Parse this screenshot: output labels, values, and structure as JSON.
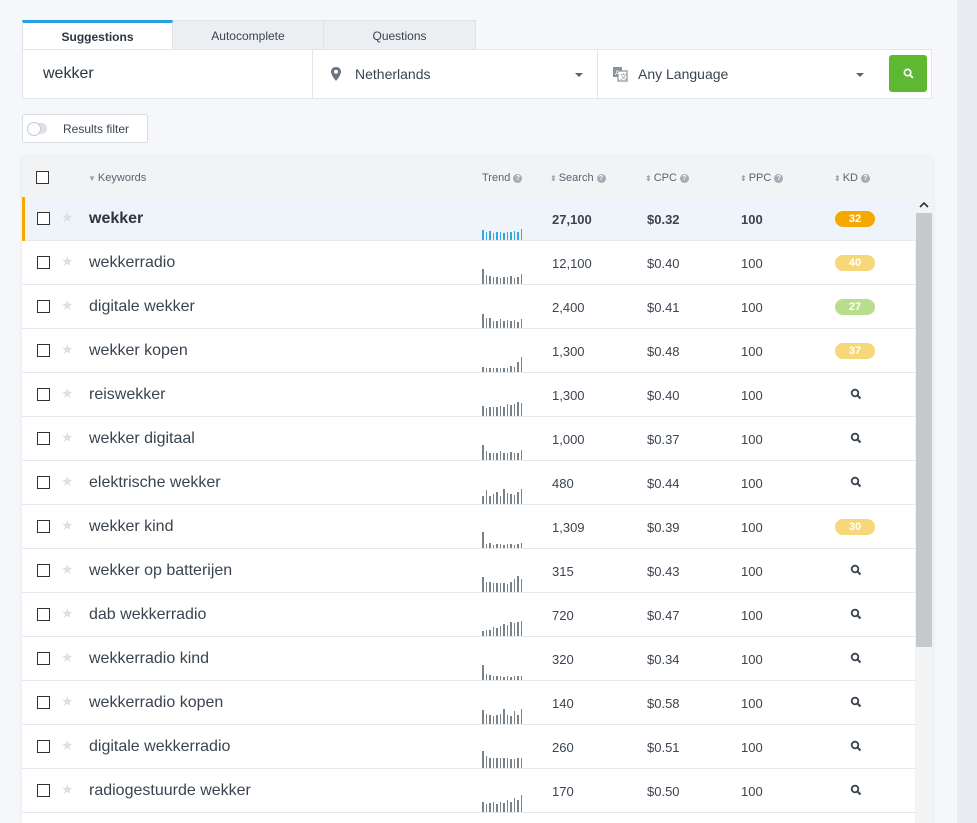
{
  "tabs": [
    {
      "label": "Suggestions",
      "active": true
    },
    {
      "label": "Autocomplete",
      "active": false
    },
    {
      "label": "Questions",
      "active": false
    }
  ],
  "search": {
    "keyword_value": "wekker",
    "location": "Netherlands",
    "language": "Any Language",
    "location_icon": "map-pin-icon",
    "language_icon": "translate-icon",
    "go_icon": "search-icon"
  },
  "filter": {
    "label": "Results filter",
    "toggle_on": false
  },
  "table": {
    "headers": {
      "keywords": "Keywords",
      "trend": "Trend",
      "search": "Search",
      "cpc": "CPC",
      "ppc": "PPC",
      "kd": "KD"
    },
    "rows": [
      {
        "keyword": "wekker",
        "search": "27,100",
        "cpc": "$0.32",
        "ppc": "100",
        "kd": "32",
        "kd_color": "#f5a800",
        "selected": true,
        "trend": [
          10,
          8,
          9,
          7,
          8,
          8,
          7,
          8,
          8,
          9,
          8,
          11
        ]
      },
      {
        "keyword": "wekkerradio",
        "search": "12,100",
        "cpc": "$0.40",
        "ppc": "100",
        "kd": "40",
        "kd_color": "#f6d77a",
        "trend": [
          15,
          9,
          8,
          7,
          7,
          6,
          7,
          7,
          8,
          6,
          7,
          10
        ]
      },
      {
        "keyword": "digitale wekker",
        "search": "2,400",
        "cpc": "$0.41",
        "ppc": "100",
        "kd": "27",
        "kd_color": "#b8dd8c",
        "trend": [
          14,
          10,
          10,
          7,
          7,
          9,
          7,
          8,
          7,
          8,
          6,
          9
        ]
      },
      {
        "keyword": "wekker kopen",
        "search": "1,300",
        "cpc": "$0.48",
        "ppc": "100",
        "kd": "37",
        "kd_color": "#f6d77a",
        "trend": [
          5,
          4,
          4,
          4,
          4,
          4,
          4,
          4,
          6,
          5,
          10,
          15
        ]
      },
      {
        "keyword": "reiswekker",
        "search": "1,300",
        "cpc": "$0.40",
        "ppc": "100",
        "kd": null,
        "trend": [
          10,
          8,
          9,
          9,
          9,
          10,
          9,
          12,
          11,
          12,
          14,
          13
        ]
      },
      {
        "keyword": "wekker digitaal",
        "search": "1,000",
        "cpc": "$0.37",
        "ppc": "100",
        "kd": null,
        "trend": [
          15,
          9,
          7,
          7,
          7,
          9,
          7,
          7,
          8,
          7,
          7,
          10
        ]
      },
      {
        "keyword": "elektrische wekker",
        "search": "480",
        "cpc": "$0.44",
        "ppc": "100",
        "kd": null,
        "trend": [
          8,
          14,
          8,
          10,
          12,
          8,
          15,
          11,
          10,
          9,
          12,
          15
        ]
      },
      {
        "keyword": "wekker kind",
        "search": "1,309",
        "cpc": "$0.39",
        "ppc": "100",
        "kd": "30",
        "kd_color": "#f6d77a",
        "trend": [
          16,
          4,
          5,
          3,
          4,
          4,
          3,
          4,
          4,
          3,
          4,
          5
        ]
      },
      {
        "keyword": "wekker op batterijen",
        "search": "315",
        "cpc": "$0.43",
        "ppc": "100",
        "kd": null,
        "trend": [
          15,
          10,
          10,
          9,
          9,
          9,
          9,
          8,
          10,
          13,
          16,
          13
        ]
      },
      {
        "keyword": "dab wekkerradio",
        "search": "720",
        "cpc": "$0.47",
        "ppc": "100",
        "kd": null,
        "trend": [
          5,
          6,
          6,
          9,
          8,
          10,
          12,
          11,
          14,
          13,
          14,
          15
        ]
      },
      {
        "keyword": "wekkerradio kind",
        "search": "320",
        "cpc": "$0.34",
        "ppc": "100",
        "kd": null,
        "trend": [
          15,
          6,
          5,
          4,
          4,
          4,
          3,
          4,
          3,
          4,
          4,
          4
        ]
      },
      {
        "keyword": "wekkerradio kopen",
        "search": "140",
        "cpc": "$0.58",
        "ppc": "100",
        "kd": null,
        "trend": [
          14,
          10,
          9,
          8,
          9,
          10,
          15,
          9,
          8,
          13,
          9,
          15
        ]
      },
      {
        "keyword": "digitale wekkerradio",
        "search": "260",
        "cpc": "$0.51",
        "ppc": "100",
        "kd": null,
        "trend": [
          17,
          12,
          10,
          10,
          10,
          10,
          10,
          10,
          9,
          9,
          10,
          10
        ]
      },
      {
        "keyword": "radiogestuurde wekker",
        "search": "170",
        "cpc": "$0.50",
        "ppc": "100",
        "kd": null,
        "trend": [
          10,
          8,
          9,
          10,
          8,
          10,
          9,
          12,
          10,
          14,
          12,
          17
        ]
      }
    ]
  }
}
